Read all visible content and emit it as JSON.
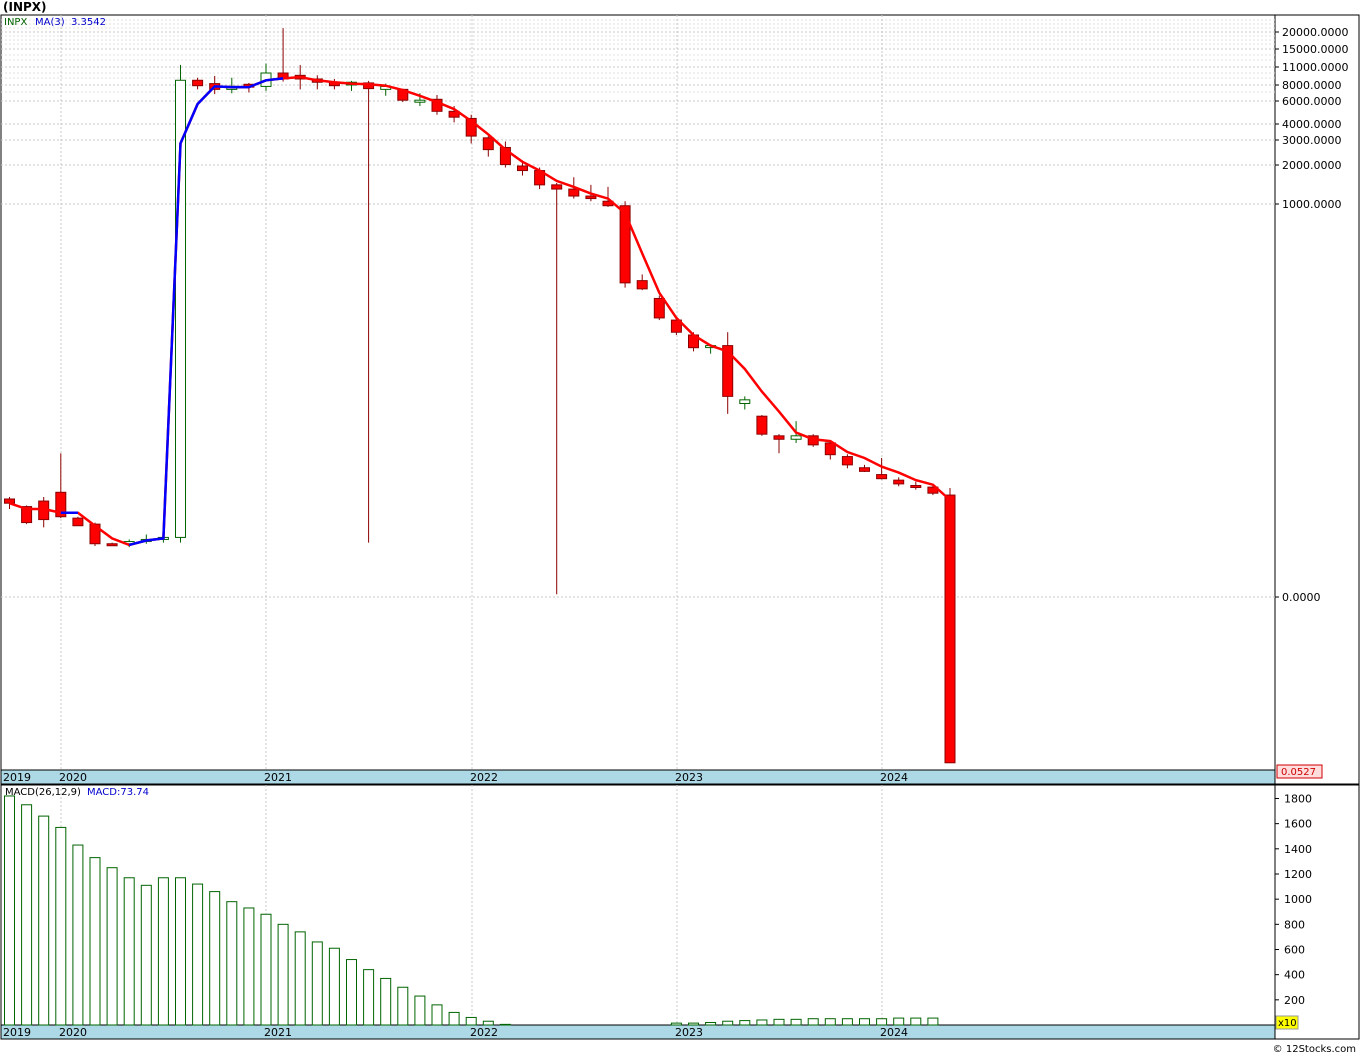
{
  "page": {
    "title": "(INPX)",
    "footer": "© 12Stocks.com"
  },
  "chart_data": [
    {
      "type": "candlestick",
      "scale": "log",
      "legend": {
        "symbol": "INPX",
        "ma_label": "MA(3)",
        "ma_value": "3.3542"
      },
      "colors": {
        "down": "#ff0000",
        "up": "#ffffff",
        "up_border": "#006400",
        "down_wick": "#8b0000",
        "ma_red": "#ff0000",
        "ma_blue": "#0000ff"
      },
      "y_tick_labels": [
        "20000.0000",
        "15000.0000",
        "11000.0000",
        "8000.0000",
        "6000.0000",
        "4000.0000",
        "3000.0000",
        "2000.0000",
        "1000.0000",
        "0.0000"
      ],
      "last_price_label": "0.0527",
      "x_labels": [
        "2019",
        "2020",
        "2021",
        "2022",
        "2023",
        "2024"
      ],
      "candles": [
        {
          "o": 5.6,
          "h": 5.8,
          "l": 4.7,
          "c": 5.2,
          "up": false
        },
        {
          "o": 4.9,
          "h": 5.0,
          "l": 3.6,
          "c": 3.7,
          "up": false
        },
        {
          "o": 3.9,
          "h": 5.8,
          "l": 3.4,
          "c": 5.4,
          "up": false
        },
        {
          "o": 6.3,
          "h": 12.5,
          "l": 4.0,
          "c": 4.1,
          "up": false
        },
        {
          "o": 4.0,
          "h": 4.1,
          "l": 3.5,
          "c": 3.5,
          "up": false
        },
        {
          "o": 3.6,
          "h": 3.7,
          "l": 2.45,
          "c": 2.55,
          "up": false
        },
        {
          "o": 2.55,
          "h": 2.6,
          "l": 2.45,
          "c": 2.5,
          "up": false
        },
        {
          "o": 2.55,
          "h": 2.75,
          "l": 2.4,
          "c": 2.65,
          "up": true
        },
        {
          "o": 2.7,
          "h": 3.0,
          "l": 2.55,
          "c": 2.75,
          "up": true
        },
        {
          "o": 2.75,
          "h": 3.0,
          "l": 2.6,
          "c": 2.85,
          "up": true
        },
        {
          "o": 2.85,
          "h": 11500,
          "l": 2.6,
          "c": 8800,
          "up": true
        },
        {
          "o": 8800,
          "h": 9200,
          "l": 7500,
          "c": 8000,
          "up": false
        },
        {
          "o": 8300,
          "h": 9500,
          "l": 6900,
          "c": 7500,
          "up": false
        },
        {
          "o": 7500,
          "h": 9200,
          "l": 7000,
          "c": 7900,
          "up": true
        },
        {
          "o": 8200,
          "h": 8400,
          "l": 7100,
          "c": 7800,
          "up": false
        },
        {
          "o": 7900,
          "h": 11800,
          "l": 7300,
          "c": 10000,
          "up": true
        },
        {
          "o": 10000,
          "h": 22000,
          "l": 8600,
          "c": 9000,
          "up": false
        },
        {
          "o": 9600,
          "h": 11500,
          "l": 7500,
          "c": 9000,
          "up": false
        },
        {
          "o": 9000,
          "h": 9600,
          "l": 7500,
          "c": 8500,
          "up": false
        },
        {
          "o": 8500,
          "h": 9000,
          "l": 7500,
          "c": 8000,
          "up": false
        },
        {
          "o": 8100,
          "h": 8700,
          "l": 7300,
          "c": 8500,
          "up": true
        },
        {
          "o": 8400,
          "h": 8700,
          "l": 2.6,
          "c": 7600,
          "up": false
        },
        {
          "o": 7900,
          "h": 8300,
          "l": 6700,
          "c": 7500,
          "up": true
        },
        {
          "o": 7500,
          "h": 7600,
          "l": 6000,
          "c": 6200,
          "up": false
        },
        {
          "o": 6200,
          "h": 7000,
          "l": 5600,
          "c": 6100,
          "up": true
        },
        {
          "o": 6300,
          "h": 6800,
          "l": 4800,
          "c": 5100,
          "up": false
        },
        {
          "o": 5100,
          "h": 5600,
          "l": 4200,
          "c": 4600,
          "up": false
        },
        {
          "o": 4500,
          "h": 4800,
          "l": 2900,
          "c": 3300,
          "up": false
        },
        {
          "o": 3200,
          "h": 3300,
          "l": 2300,
          "c": 2600,
          "up": false
        },
        {
          "o": 2700,
          "h": 3000,
          "l": 1900,
          "c": 2000,
          "up": false
        },
        {
          "o": 1950,
          "h": 2050,
          "l": 1650,
          "c": 1800,
          "up": false
        },
        {
          "o": 1800,
          "h": 1900,
          "l": 1300,
          "c": 1400,
          "up": false
        },
        {
          "o": 1400,
          "h": 1450,
          "l": 1.05,
          "c": 1300,
          "up": false
        },
        {
          "o": 1300,
          "h": 1600,
          "l": 1100,
          "c": 1150,
          "up": false
        },
        {
          "o": 1150,
          "h": 1400,
          "l": 1050,
          "c": 1100,
          "up": false
        },
        {
          "o": 1050,
          "h": 1350,
          "l": 950,
          "c": 970,
          "up": false
        },
        {
          "o": 970,
          "h": 1050,
          "l": 230,
          "c": 250,
          "up": false
        },
        {
          "o": 260,
          "h": 290,
          "l": 220,
          "c": 225,
          "up": false
        },
        {
          "o": 190,
          "h": 200,
          "l": 130,
          "c": 135,
          "up": false
        },
        {
          "o": 130,
          "h": 135,
          "l": 100,
          "c": 105,
          "up": false
        },
        {
          "o": 100,
          "h": 105,
          "l": 75,
          "c": 80,
          "up": false
        },
        {
          "o": 82,
          "h": 85,
          "l": 72,
          "c": 83,
          "up": true
        },
        {
          "o": 83,
          "h": 105,
          "l": 25,
          "c": 34,
          "up": false
        },
        {
          "o": 30,
          "h": 34,
          "l": 27,
          "c": 32,
          "up": true
        },
        {
          "o": 24,
          "h": 24.5,
          "l": 17,
          "c": 17.5,
          "up": false
        },
        {
          "o": 17,
          "h": 17.5,
          "l": 12.5,
          "c": 16,
          "up": false
        },
        {
          "o": 16,
          "h": 22,
          "l": 15,
          "c": 17,
          "up": true
        },
        {
          "o": 17,
          "h": 17.5,
          "l": 14,
          "c": 14.5,
          "up": false
        },
        {
          "o": 15,
          "h": 15.5,
          "l": 11.2,
          "c": 12.2,
          "up": false
        },
        {
          "o": 11.8,
          "h": 12.3,
          "l": 9.6,
          "c": 10.2,
          "up": false
        },
        {
          "o": 9.7,
          "h": 10.2,
          "l": 9.0,
          "c": 9.1,
          "up": false
        },
        {
          "o": 8.6,
          "h": 11.5,
          "l": 7.9,
          "c": 8.0,
          "up": false
        },
        {
          "o": 7.8,
          "h": 8.2,
          "l": 7.0,
          "c": 7.3,
          "up": false
        },
        {
          "o": 7.1,
          "h": 7.6,
          "l": 6.6,
          "c": 7.0,
          "up": false
        },
        {
          "o": 6.9,
          "h": 7.3,
          "l": 6.0,
          "c": 6.2,
          "up": false
        },
        {
          "o": 6.0,
          "h": 6.8,
          "l": 0.052,
          "c": 0.0527,
          "up": false
        }
      ],
      "ma": [
        5.2,
        4.7,
        4.7,
        4.4,
        4.4,
        3.5,
        2.8,
        2.5,
        2.7,
        2.8,
        2900,
        5800,
        7900,
        7800,
        7800,
        8800,
        9100,
        9300,
        8800,
        8500,
        8300,
        8200,
        8000,
        7400,
        6700,
        6000,
        5300,
        4300,
        3400,
        2600,
        2100,
        1800,
        1500,
        1350,
        1200,
        1100,
        850,
        420,
        210,
        135,
        100,
        83,
        75,
        55,
        37,
        26,
        18,
        16,
        15.5,
        12.8,
        11.5,
        9.9,
        8.9,
        7.8,
        7.2,
        5.5
      ],
      "ma_blue_ranges": [
        [
          3,
          3
        ],
        [
          7,
          16
        ]
      ]
    },
    {
      "type": "bar",
      "legend": {
        "label": "MACD(26,12,9)",
        "value": "MACD:73.74"
      },
      "colors": {
        "bar_border": "#006400"
      },
      "y_tick_labels": [
        "1800",
        "1600",
        "1400",
        "1200",
        "1000",
        "800",
        "600",
        "400",
        "200"
      ],
      "x_labels": [
        "2019",
        "2020",
        "2021",
        "2022",
        "2023",
        "2024"
      ],
      "multiplier_label": "x10",
      "values": [
        1820,
        1750,
        1660,
        1570,
        1430,
        1330,
        1250,
        1170,
        1110,
        1170,
        1170,
        1120,
        1060,
        980,
        930,
        880,
        800,
        740,
        660,
        610,
        520,
        440,
        370,
        300,
        230,
        160,
        100,
        60,
        30,
        5,
        0,
        0,
        0,
        0,
        0,
        0,
        0,
        0,
        0,
        15,
        15,
        20,
        30,
        35,
        40,
        45,
        45,
        50,
        50,
        50,
        50,
        50,
        55,
        55,
        55
      ]
    }
  ]
}
